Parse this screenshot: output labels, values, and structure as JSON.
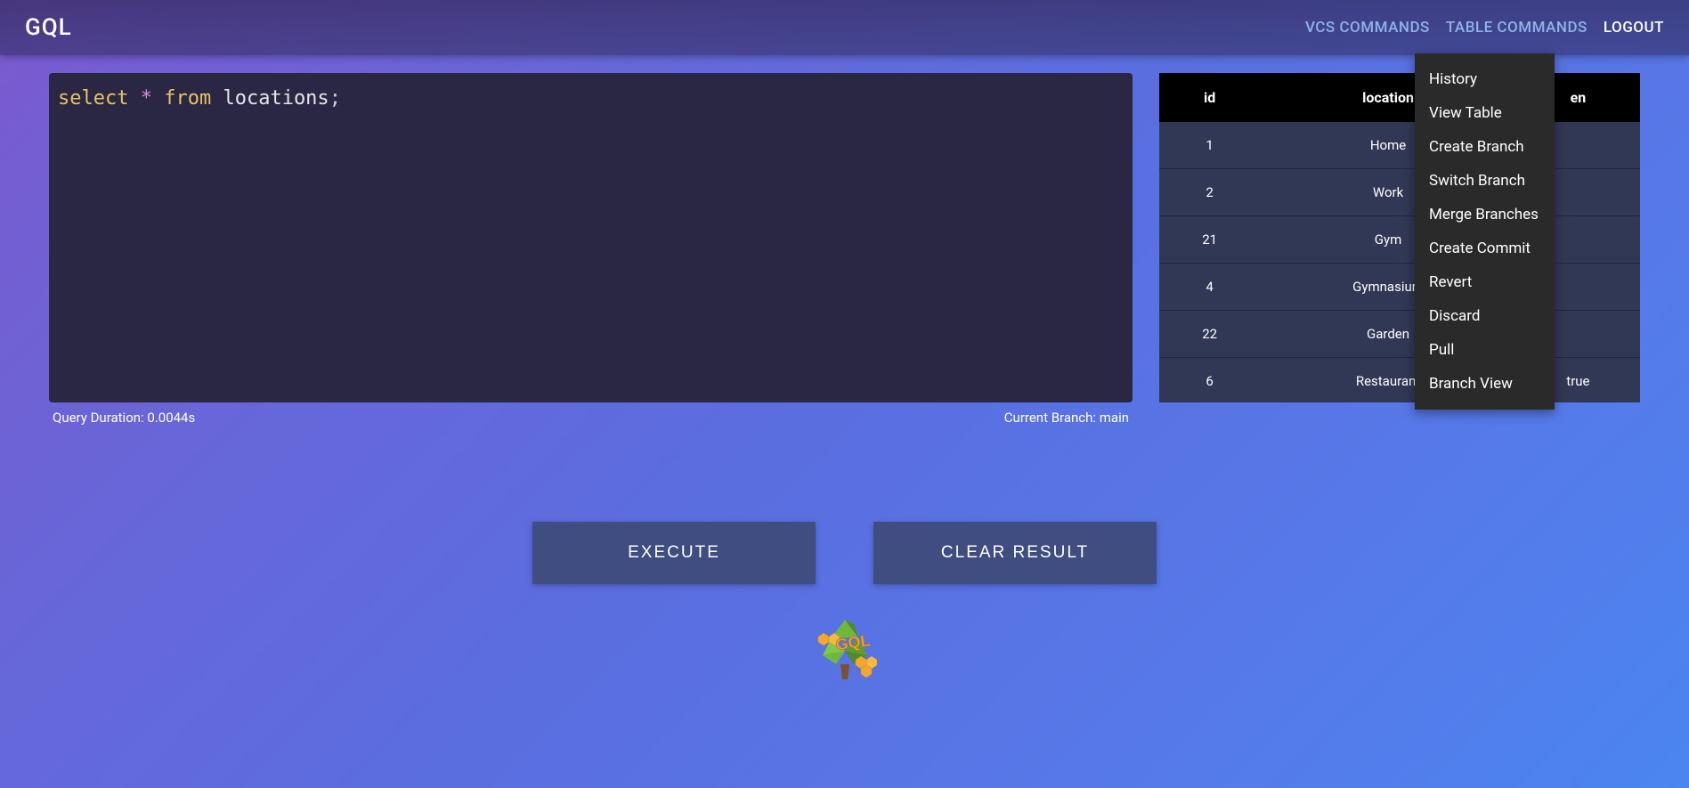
{
  "navbar": {
    "logo": "GQL",
    "links": {
      "vcs": "VCS COMMANDS",
      "table": "TABLE COMMANDS",
      "logout": "LOGOUT"
    }
  },
  "editor": {
    "sql_kw1": "select",
    "sql_star": "*",
    "sql_kw2": "from",
    "sql_ident": "locations",
    "sql_semi": ";",
    "query_duration": "Query Duration: 0.0044s",
    "current_branch": "Current Branch: main"
  },
  "table": {
    "headers": [
      "id",
      "location",
      "en"
    ],
    "rows": [
      {
        "id": "1",
        "location": "Home",
        "col3": ""
      },
      {
        "id": "2",
        "location": "Work",
        "col3": ""
      },
      {
        "id": "21",
        "location": "Gym",
        "col3": ""
      },
      {
        "id": "4",
        "location": "Gymnasium",
        "col3": ""
      },
      {
        "id": "22",
        "location": "Garden",
        "col3": ""
      },
      {
        "id": "6",
        "location": "Restaurant",
        "col3": "true"
      }
    ]
  },
  "dropdown": {
    "items": [
      "History",
      "View Table",
      "Create Branch",
      "Switch Branch",
      "Merge Branches",
      "Create Commit",
      "Revert",
      "Discard",
      "Pull",
      "Branch View"
    ]
  },
  "buttons": {
    "execute": "EXECUTE",
    "clear": "CLEAR RESULT"
  }
}
